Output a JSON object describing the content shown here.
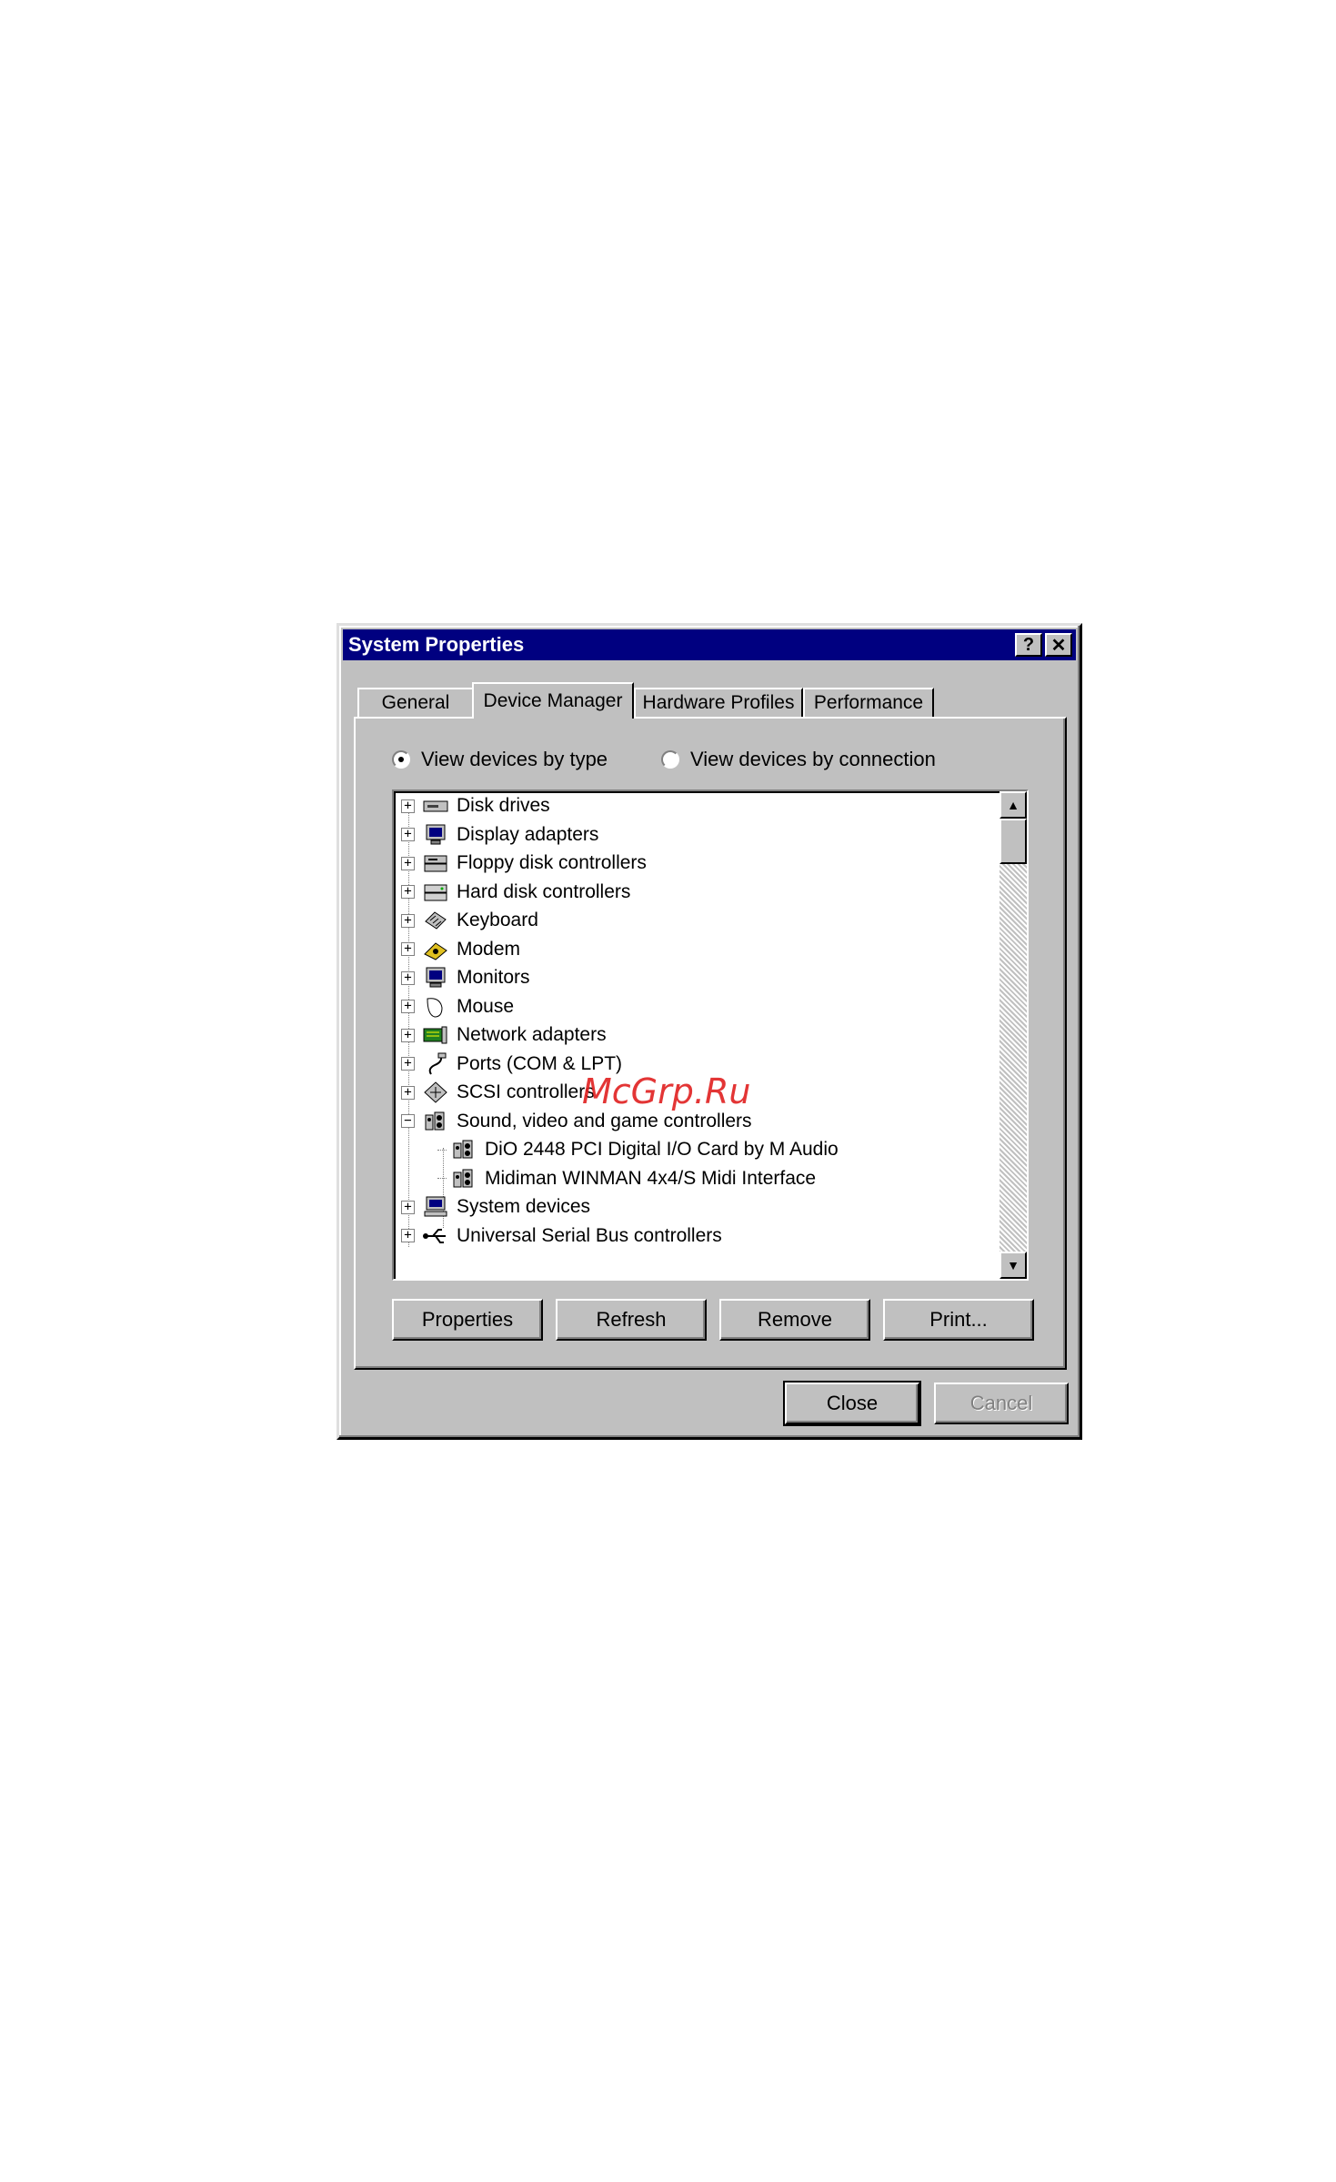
{
  "window": {
    "title": "System Properties",
    "help_glyph": "?",
    "close_glyph": "✕"
  },
  "tabs": [
    {
      "label": "General",
      "active": false
    },
    {
      "label": "Device Manager",
      "active": true
    },
    {
      "label": "Hardware Profiles",
      "active": false
    },
    {
      "label": "Performance",
      "active": false
    }
  ],
  "view_options": {
    "by_type": {
      "label": "View devices by type",
      "selected": true
    },
    "by_connection": {
      "label": "View devices by connection",
      "selected": false
    }
  },
  "tree": {
    "items": [
      {
        "label": "Disk drives",
        "icon": "disk-drive-icon",
        "expanded": false,
        "level": 0
      },
      {
        "label": "Display adapters",
        "icon": "display-adapter-icon",
        "expanded": false,
        "level": 0
      },
      {
        "label": "Floppy disk controllers",
        "icon": "floppy-controller-icon",
        "expanded": false,
        "level": 0
      },
      {
        "label": "Hard disk controllers",
        "icon": "hard-disk-controller-icon",
        "expanded": false,
        "level": 0
      },
      {
        "label": "Keyboard",
        "icon": "keyboard-icon",
        "expanded": false,
        "level": 0
      },
      {
        "label": "Modem",
        "icon": "modem-icon",
        "expanded": false,
        "level": 0
      },
      {
        "label": "Monitors",
        "icon": "monitor-icon",
        "expanded": false,
        "level": 0
      },
      {
        "label": "Mouse",
        "icon": "mouse-icon",
        "expanded": false,
        "level": 0
      },
      {
        "label": "Network adapters",
        "icon": "network-adapter-icon",
        "expanded": false,
        "level": 0
      },
      {
        "label": "Ports (COM & LPT)",
        "icon": "port-icon",
        "expanded": false,
        "level": 0
      },
      {
        "label": "SCSI controllers",
        "icon": "scsi-controller-icon",
        "expanded": false,
        "level": 0
      },
      {
        "label": "Sound, video and game controllers",
        "icon": "sound-controller-icon",
        "expanded": true,
        "level": 0
      },
      {
        "label": "DiO 2448 PCI Digital I/O Card by M Audio",
        "icon": "sound-device-icon",
        "level": 1
      },
      {
        "label": "Midiman WINMAN 4x4/S Midi Interface",
        "icon": "sound-device-icon",
        "level": 1
      },
      {
        "label": "System devices",
        "icon": "system-device-icon",
        "expanded": false,
        "level": 0
      },
      {
        "label": "Universal Serial Bus controllers",
        "icon": "usb-controller-icon",
        "expanded": false,
        "level": 0
      }
    ]
  },
  "buttons": {
    "properties": "Properties",
    "refresh": "Refresh",
    "remove": "Remove",
    "print": "Print...",
    "close": "Close",
    "cancel": "Cancel"
  },
  "watermark": "McGrp.Ru",
  "colors": {
    "title_bar": "#000080",
    "face": "#c0c0c0",
    "watermark": "#e02020"
  }
}
